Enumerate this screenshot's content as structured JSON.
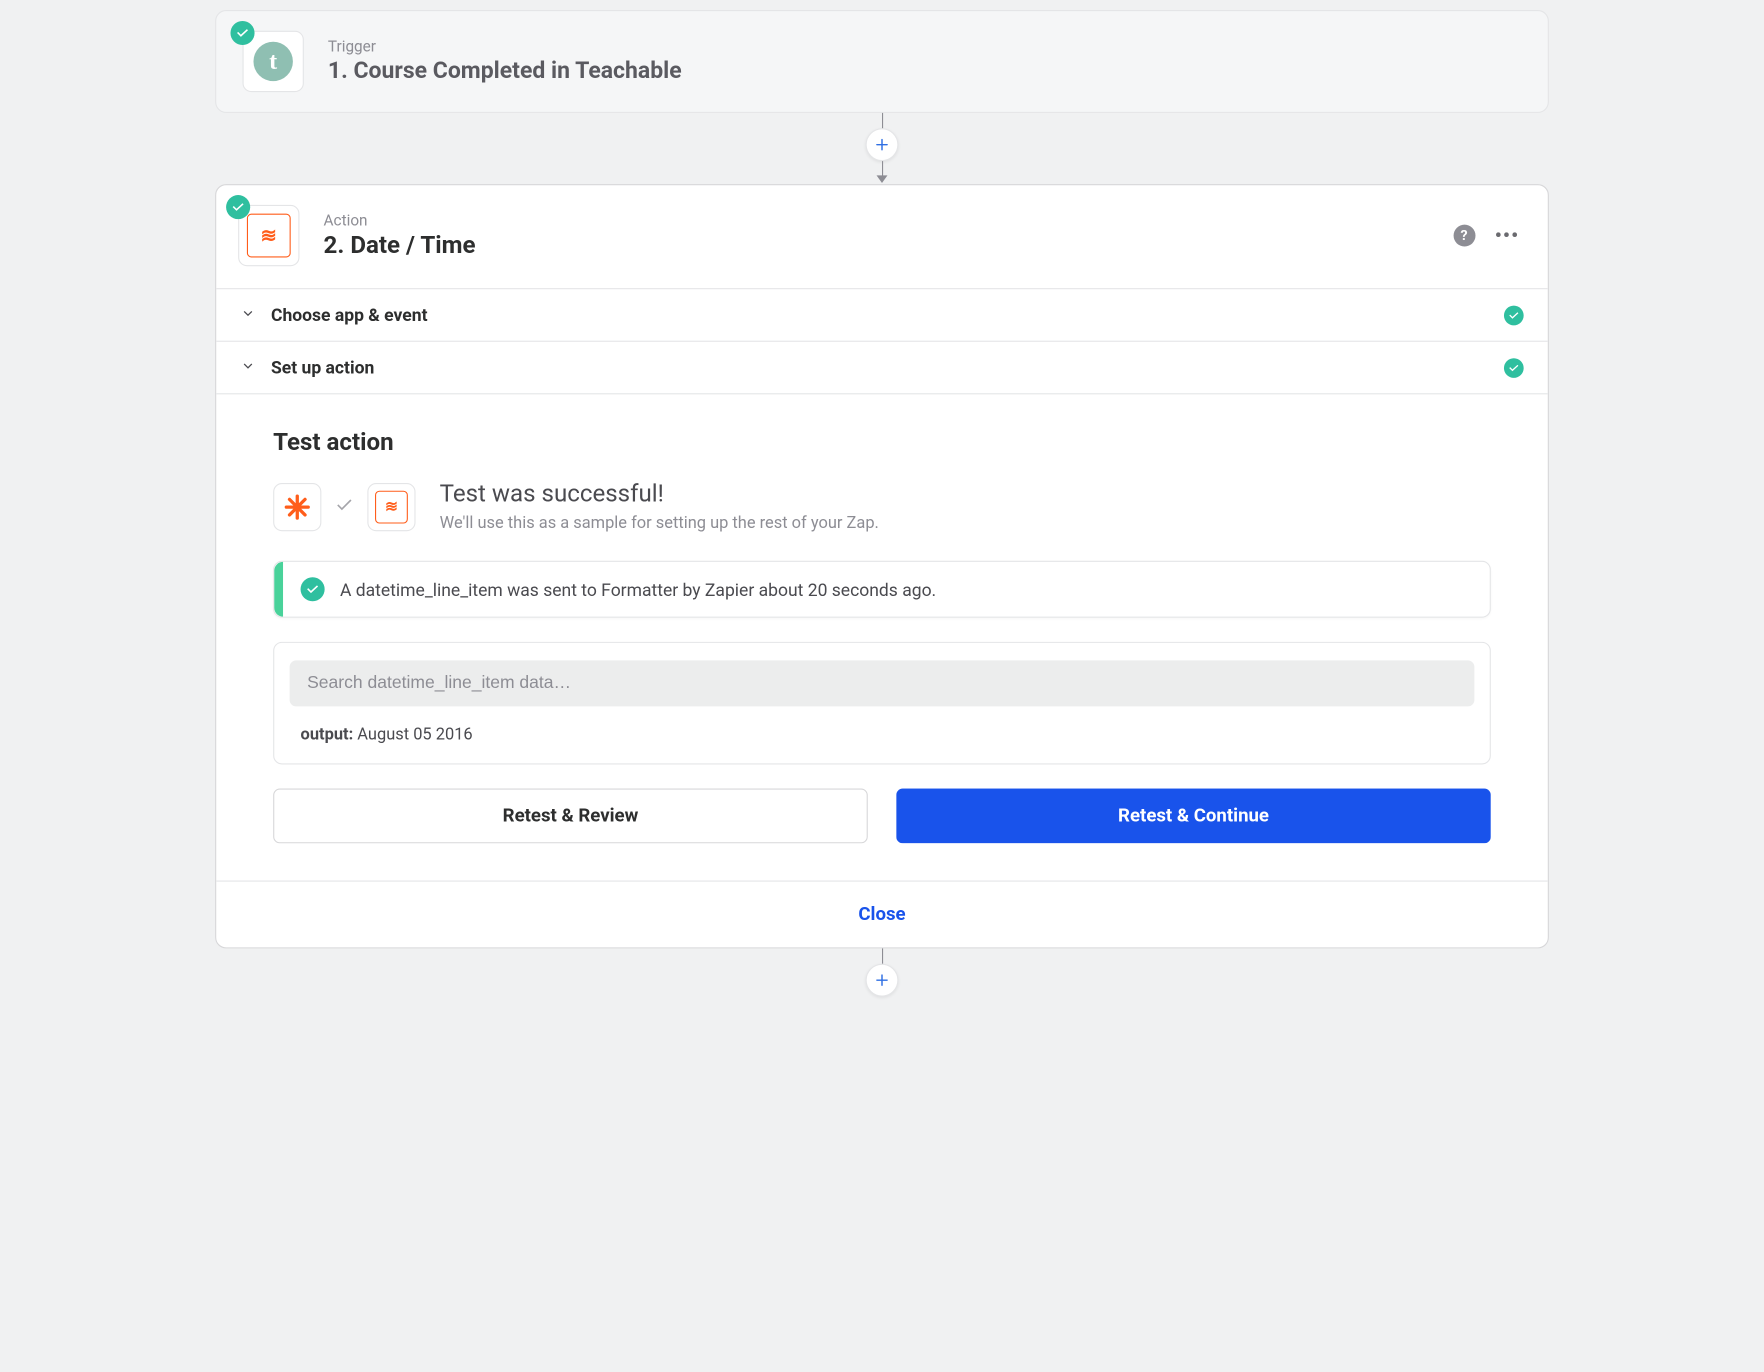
{
  "trigger": {
    "label": "Trigger",
    "title": "1. Course Completed in Teachable",
    "app_letter": "t"
  },
  "action": {
    "label": "Action",
    "title": "2. Date / Time"
  },
  "sections": {
    "choose": "Choose app & event",
    "setup": "Set up action",
    "test_heading": "Test action"
  },
  "test": {
    "success_title": "Test was successful!",
    "success_sub": "We'll use this as a sample for setting up the rest of your Zap.",
    "notice": "A datetime_line_item was sent to Formatter by Zapier about 20 seconds ago."
  },
  "results": {
    "search_placeholder": "Search datetime_line_item data…",
    "output_key": "output:",
    "output_value": "August 05 2016"
  },
  "buttons": {
    "retest_review": "Retest & Review",
    "retest_continue": "Retest & Continue",
    "close": "Close"
  }
}
